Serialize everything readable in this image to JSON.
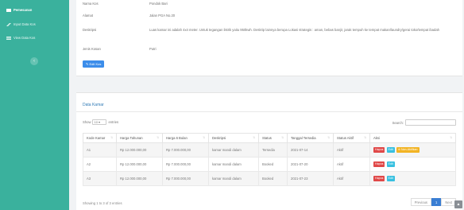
{
  "sidebar": {
    "items": [
      {
        "label": "Pemesanan",
        "icon": "receipt-icon"
      },
      {
        "label": "Input Data Kos",
        "icon": "edit-icon"
      },
      {
        "label": "View Data Kos",
        "icon": "list-icon"
      }
    ],
    "toggle_glyph": "‹"
  },
  "info": {
    "rows": [
      {
        "label": "Nama Kos",
        "value": "Pondok Bari"
      },
      {
        "label": "Alamat",
        "value": "Jalan PGA No.20"
      },
      {
        "label": "Deskripsi",
        "value": "Luas kamar ini adalah 4x4 meter. Untuk tegangan listrik yaitu 950kwh. Deskrip lainnya berupa Lokasi strategis : aman, bebas banjir, jarak tempuh ke tempat makan/laundry/gerai toko/tempat ibadah"
      },
      {
        "label": "Jenis Kosan",
        "value": "Putri"
      }
    ],
    "edit_label": "✎ Edit Kos"
  },
  "kamar": {
    "title": "Data Kamar",
    "show_prefix": "Show",
    "show_value": "10 ▾",
    "show_suffix": "entries",
    "search_label": "Search:",
    "columns": [
      "Kode Kamar",
      "Harga Tahunan",
      "Harga 6 Bulan",
      "Deskripsi",
      "Status",
      "Tanggal Tersedia",
      "Status Aktif",
      "Aksi"
    ],
    "rows": [
      {
        "kode": "A1",
        "tahunan": "Rp 12.000.000,00",
        "enam": "Rp 7.000.000,00",
        "desk": "kamar mandi dalam",
        "status": "Tersedia",
        "tanggal": "2021-07-14",
        "aktif": "Aktif"
      },
      {
        "kode": "A2",
        "tahunan": "Rp 12.000.000,00",
        "enam": "Rp 7.000.000,00",
        "desk": "kamar mandi dalam",
        "status": "Booked",
        "tanggal": "2021-07-20",
        "aktif": "Aktif"
      },
      {
        "kode": "A3",
        "tahunan": "Rp 12.000.000,00",
        "enam": "Rp 7.000.000,00",
        "desk": "kamar mandi dalam",
        "status": "Booked",
        "tanggal": "2021-07-23",
        "aktif": "Aktif"
      }
    ],
    "action_hapus": "Hapus",
    "action_edit": "Edit",
    "action_nonaktif": "⊘ Non-Aktifkan",
    "showing": "Showing 1 to 3 of 3 entries",
    "pager": {
      "previous": "Previous",
      "page": "1",
      "next": "Next"
    }
  },
  "scroll_glyph": "▲",
  "colors": {
    "sidebar": "#3ab19d",
    "title": "#2f79b5",
    "edit": "#3c8dea",
    "hapus": "#e04848",
    "edit_row": "#38c0e0",
    "nonaktif": "#f2b425"
  }
}
